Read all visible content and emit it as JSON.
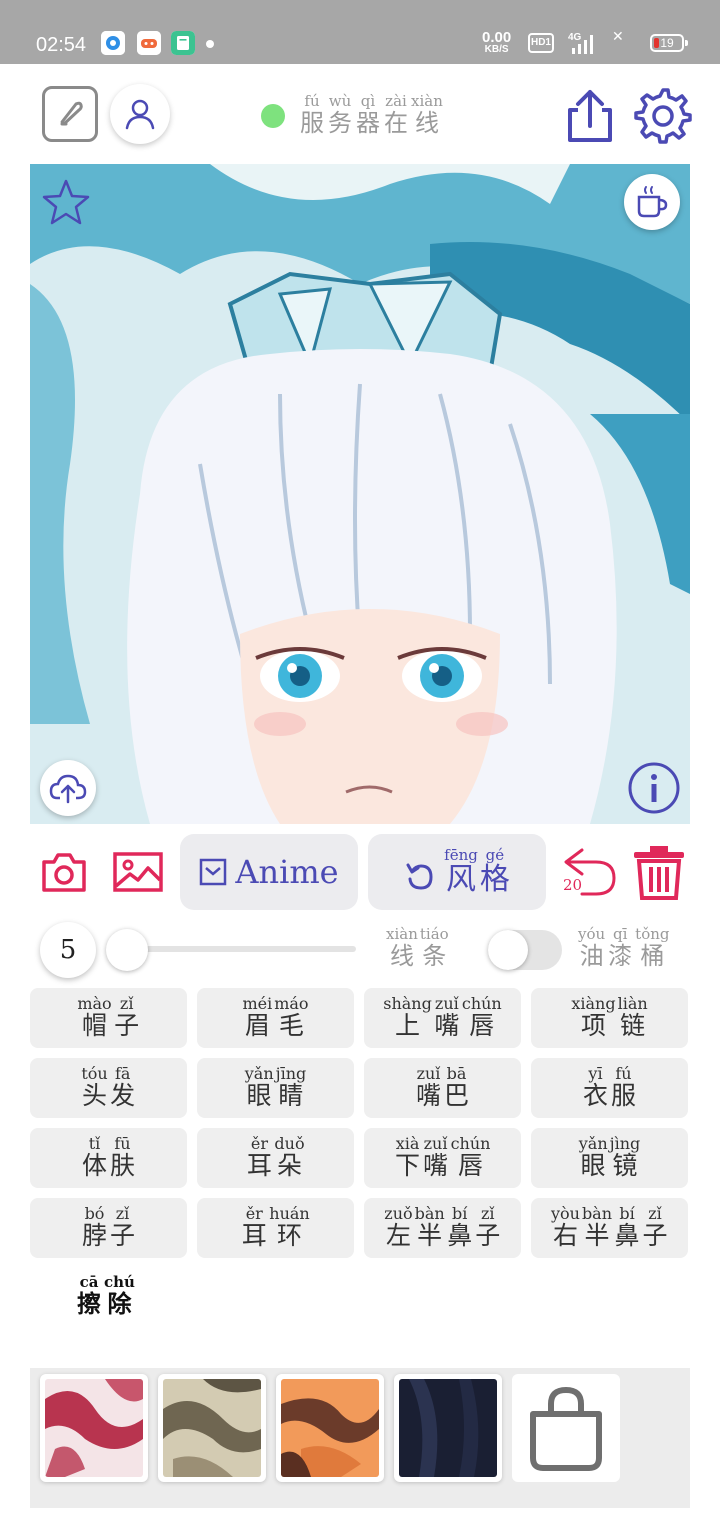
{
  "status_bar": {
    "time": "02:54",
    "net_speed_value": "0.00",
    "net_speed_unit": "KB/S",
    "hd_badge": "HD1",
    "signal_label": "4G",
    "battery": "19"
  },
  "header": {
    "server_status": [
      {
        "py": "fú",
        "hz": "服"
      },
      {
        "py": "wù",
        "hz": "务"
      },
      {
        "py": "qì",
        "hz": "器"
      },
      {
        "py": "zài",
        "hz": "在"
      },
      {
        "py": "xiàn",
        "hz": "线"
      }
    ],
    "server_status_color": "#7ee27e"
  },
  "toolbar": {
    "model_label": "Anime",
    "style_button": [
      {
        "py": "fēng",
        "hz": "风"
      },
      {
        "py": "gé",
        "hz": "格"
      }
    ],
    "undo_count": "20",
    "accent_color": "#e0285a",
    "primary_color": "#4b4ab4"
  },
  "brush": {
    "size": "5",
    "slider_level": 0.0,
    "lines_label": [
      {
        "py": "xiàn",
        "hz": "线"
      },
      {
        "py": "tiáo",
        "hz": "条"
      }
    ],
    "oil_label": [
      {
        "py": "yóu",
        "hz": "油"
      },
      {
        "py": "qī",
        "hz": "漆"
      },
      {
        "py": "tǒng",
        "hz": "桶"
      }
    ],
    "oil_toggle_on": false
  },
  "parts": [
    [
      {
        "py": "mào",
        "hz": "帽"
      },
      {
        "py": "zǐ",
        "hz": "子"
      }
    ],
    [
      {
        "py": "méi",
        "hz": "眉"
      },
      {
        "py": "máo",
        "hz": "毛"
      }
    ],
    [
      {
        "py": "shàng",
        "hz": "上"
      },
      {
        "py": "zuǐ",
        "hz": "嘴"
      },
      {
        "py": "chún",
        "hz": "唇"
      }
    ],
    [
      {
        "py": "xiàng",
        "hz": "项"
      },
      {
        "py": "liàn",
        "hz": "链"
      }
    ],
    [
      {
        "py": "tóu",
        "hz": "头"
      },
      {
        "py": "fā",
        "hz": "发"
      }
    ],
    [
      {
        "py": "yǎn",
        "hz": "眼"
      },
      {
        "py": "jīng",
        "hz": "睛"
      }
    ],
    [
      {
        "py": "zuǐ",
        "hz": "嘴"
      },
      {
        "py": "bā",
        "hz": "巴"
      }
    ],
    [
      {
        "py": "yī",
        "hz": "衣"
      },
      {
        "py": "fú",
        "hz": "服"
      }
    ],
    [
      {
        "py": "tǐ",
        "hz": "体"
      },
      {
        "py": "fū",
        "hz": "肤"
      }
    ],
    [
      {
        "py": "ěr",
        "hz": "耳"
      },
      {
        "py": "duǒ",
        "hz": "朵"
      }
    ],
    [
      {
        "py": "xià",
        "hz": "下"
      },
      {
        "py": "zuǐ",
        "hz": "嘴"
      },
      {
        "py": "chún",
        "hz": "唇"
      }
    ],
    [
      {
        "py": "yǎn",
        "hz": "眼"
      },
      {
        "py": "jìng",
        "hz": "镜"
      }
    ],
    [
      {
        "py": "bó",
        "hz": "脖"
      },
      {
        "py": "zǐ",
        "hz": "子"
      }
    ],
    [
      {
        "py": "ěr",
        "hz": "耳"
      },
      {
        "py": "huán",
        "hz": "环"
      }
    ],
    [
      {
        "py": "zuǒ",
        "hz": "左"
      },
      {
        "py": "bàn",
        "hz": "半"
      },
      {
        "py": "bí",
        "hz": "鼻"
      },
      {
        "py": "zǐ",
        "hz": "子"
      }
    ],
    [
      {
        "py": "yòu",
        "hz": "右"
      },
      {
        "py": "bàn",
        "hz": "半"
      },
      {
        "py": "bí",
        "hz": "鼻"
      },
      {
        "py": "zǐ",
        "hz": "子"
      }
    ]
  ],
  "erase_label": [
    {
      "py": "cā",
      "hz": "擦"
    },
    {
      "py": "chú",
      "hz": "除"
    }
  ],
  "textures": [
    {
      "name": "red-white-texture",
      "color": "#b8344f"
    },
    {
      "name": "khaki-texture",
      "color": "#9b8f75"
    },
    {
      "name": "orange-texture",
      "color": "#e07a3c"
    },
    {
      "name": "dark-navy-texture",
      "color": "#1a1f33"
    }
  ]
}
